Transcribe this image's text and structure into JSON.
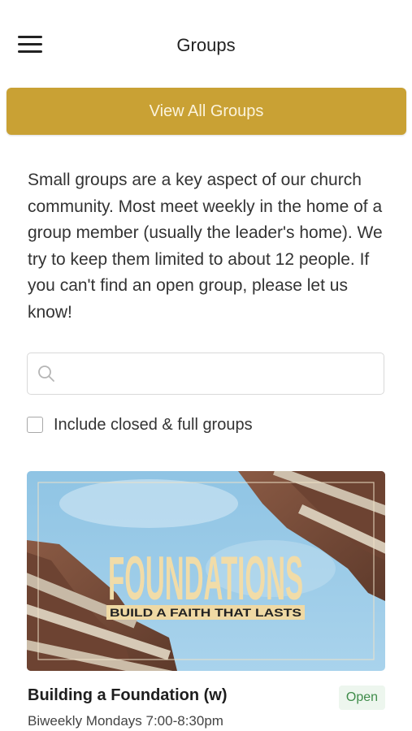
{
  "header": {
    "title": "Groups",
    "menu_icon": "hamburger-menu-icon"
  },
  "view_all_button": {
    "label": "View All Groups",
    "color": "#c9a134"
  },
  "intro": {
    "text": "Small groups are a key aspect of our church community. Most meet weekly in the home of a group member (usually the leader's home). We try to keep them limited to about 12 people. If you can't find an open group, please let us know!"
  },
  "search": {
    "placeholder": "",
    "value": "",
    "icon": "search-icon"
  },
  "filter": {
    "label": "Include closed & full groups",
    "checked": false
  },
  "groups": [
    {
      "image_title": "FOUNDATIONS",
      "image_tagline": "BUILD A FAITH THAT LASTS",
      "name": "Building a Foundation (w)",
      "status": "Open",
      "status_color": "#3f8c4a",
      "schedule": "Biweekly Mondays 7:00-8:30pm"
    }
  ]
}
